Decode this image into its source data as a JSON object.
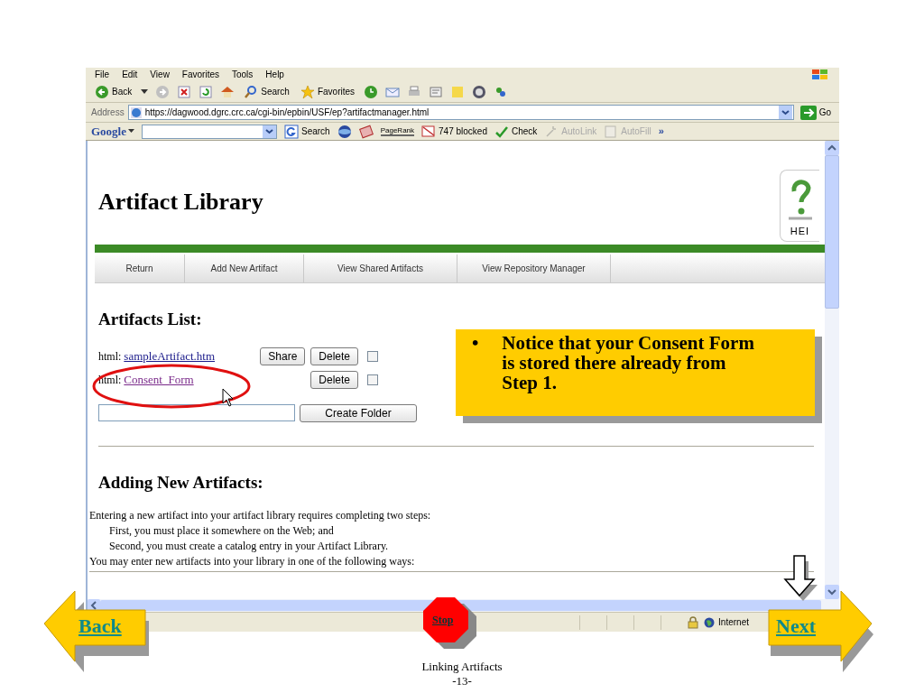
{
  "browser": {
    "menu": [
      "File",
      "Edit",
      "View",
      "Favorites",
      "Tools",
      "Help"
    ],
    "toolbar": [
      {
        "kind": "back",
        "label": "Back"
      },
      {
        "kind": "search",
        "label": "Search"
      },
      {
        "kind": "favorites",
        "label": "Favorites"
      }
    ],
    "address": {
      "label": "Address",
      "url": "https://dagwood.dgrc.crc.ca/cgi-bin/epbin/USF/ep?artifactmanager.html",
      "go": "Go"
    },
    "google_bar": {
      "logo": "Google",
      "items": [
        {
          "label": "Search",
          "disabled": false
        },
        {
          "label": "PageRank",
          "disabled": false
        },
        {
          "label": "747 blocked",
          "disabled": false
        },
        {
          "label": "Check",
          "disabled": false
        },
        {
          "label": "AutoLink",
          "disabled": true
        },
        {
          "label": "AutoFill",
          "disabled": true
        }
      ],
      "more": "»"
    },
    "status_bar": {
      "zone": "Internet"
    }
  },
  "page": {
    "title": "Artifact Library",
    "logo_text": "HEI",
    "nav": [
      "Return",
      "Add New Artifact",
      "View Shared Artifacts",
      "View Repository Manager"
    ],
    "list_heading": "Artifacts List:",
    "artifacts": [
      {
        "type": "html:",
        "name": "sampleArtifact.htm",
        "visited": false,
        "buttons": [
          "Share",
          "Delete"
        ],
        "checked": false
      },
      {
        "type": "html:",
        "name": "Consent_Form",
        "visited": true,
        "buttons": [
          "Delete"
        ],
        "checked": false
      }
    ],
    "create_folder": "Create Folder",
    "adding_heading": "Adding New Artifacts:",
    "paragraph": [
      {
        "kind": "plain",
        "text": "Entering a new artifact into your artifact library requires completing two steps:"
      },
      {
        "kind": "indent",
        "text": "First, you must place it somewhere on the Web; and"
      },
      {
        "kind": "indent",
        "text": "Second, you must create a catalog entry in your Artifact Library."
      },
      {
        "kind": "plain",
        "text": "You may enter new artifacts into your library in one of the following ways:"
      }
    ]
  },
  "callout": {
    "bullet": "•",
    "text": "Notice that your Consent Form is stored there already from Step 1."
  },
  "slide_nav": {
    "back": "Back",
    "stop": "Stop",
    "next": "Next"
  },
  "footer": {
    "title": "Linking Artifacts",
    "page": "-13-"
  }
}
